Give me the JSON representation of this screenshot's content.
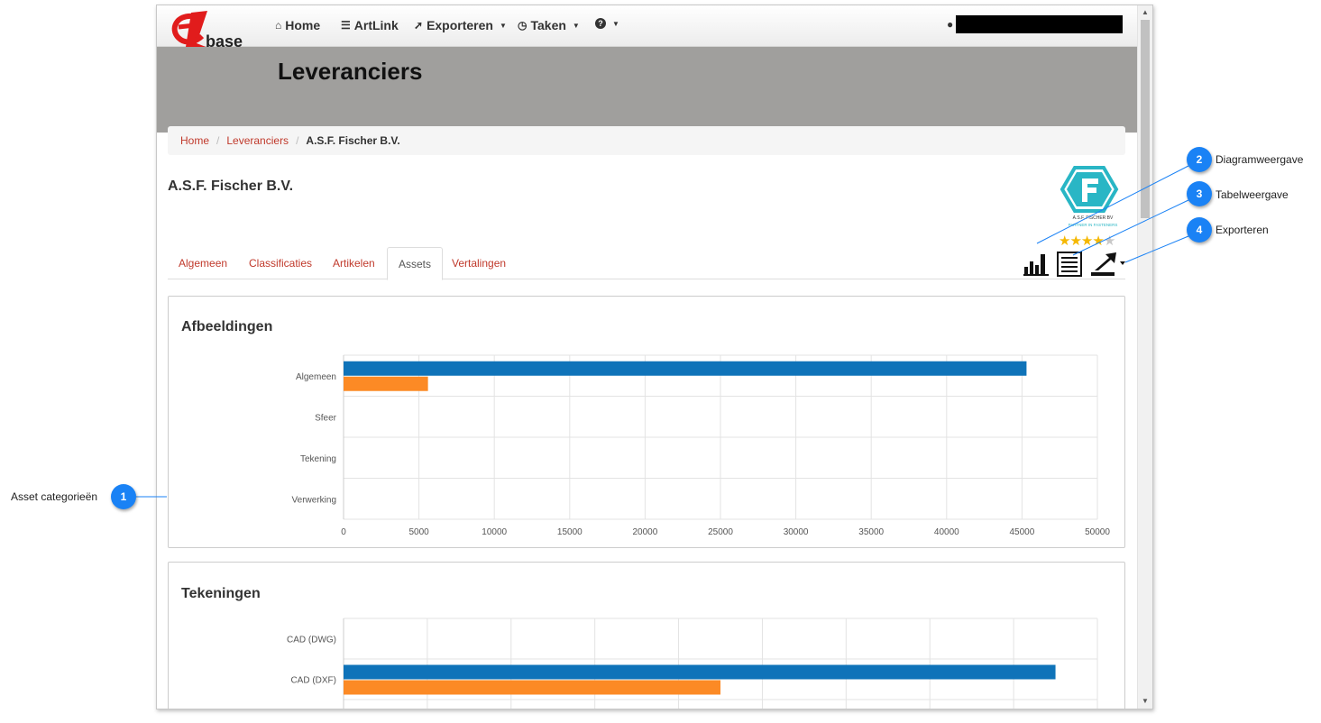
{
  "navbar": {
    "logo_text": "base",
    "items": [
      {
        "label": "Home",
        "icon": "home-icon"
      },
      {
        "label": "ArtLink",
        "icon": "list-icon"
      },
      {
        "label": "Exporteren",
        "icon": "export-icon"
      },
      {
        "label": "Taken",
        "icon": "clock-icon"
      },
      {
        "label": "",
        "icon": "help-icon"
      }
    ]
  },
  "header": {
    "title": "Leveranciers"
  },
  "breadcrumb": [
    "Home",
    "Leveranciers",
    "A.S.F. Fischer B.V."
  ],
  "supplier": {
    "name": "A.S.F. Fischer B.V.",
    "logo_text": "A.S.F. FISCHER BV",
    "logo_tagline": "PARTNER IN FASTENERS",
    "rating": 4,
    "rating_max": 5
  },
  "tabs": [
    {
      "label": "Algemeen",
      "active": false
    },
    {
      "label": "Classificaties",
      "active": false
    },
    {
      "label": "Artikelen",
      "active": false
    },
    {
      "label": "Assets",
      "active": true
    },
    {
      "label": "Vertalingen",
      "active": false
    }
  ],
  "view_icons": [
    "bar-chart-icon",
    "table-list-icon",
    "export-arrow-icon"
  ],
  "colors": {
    "series1": "#0f73b9",
    "series2": "#fc8a25",
    "link": "#c0392b",
    "callout": "#1a82f5"
  },
  "chart_data": [
    {
      "type": "bar",
      "orientation": "horizontal",
      "title": "Afbeeldingen",
      "categories": [
        "Algemeen",
        "Sfeer",
        "Tekening",
        "Verwerking"
      ],
      "series": [
        {
          "values": [
            45300,
            0,
            0,
            0
          ]
        },
        {
          "values": [
            5600,
            0,
            0,
            0
          ]
        }
      ],
      "xlim": [
        0,
        50000
      ],
      "xticks": [
        0,
        5000,
        10000,
        15000,
        20000,
        25000,
        30000,
        35000,
        40000,
        45000,
        50000
      ],
      "grid": true
    },
    {
      "type": "bar",
      "orientation": "horizontal",
      "title": "Tekeningen",
      "categories": [
        "CAD (DWG)",
        "CAD (DXF)"
      ],
      "series": [
        {
          "values": [
            0,
            4250
          ]
        },
        {
          "values": [
            0,
            2250
          ]
        }
      ],
      "xlim": [
        0,
        4500
      ],
      "grid": true
    }
  ],
  "annotations": [
    {
      "number": "1",
      "label": "Asset categorieën"
    },
    {
      "number": "2",
      "label": "Diagramweergave"
    },
    {
      "number": "3",
      "label": "Tabelweergave"
    },
    {
      "number": "4",
      "label": "Exporteren"
    }
  ]
}
